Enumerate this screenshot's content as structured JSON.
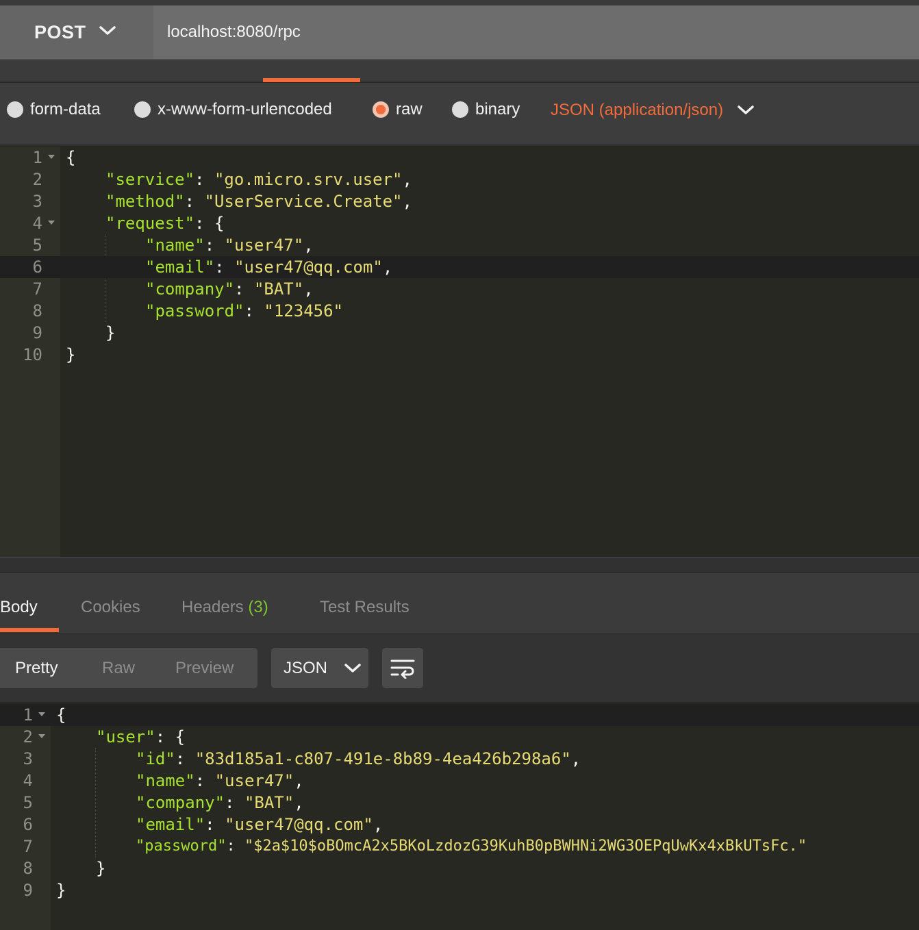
{
  "request": {
    "method": "POST",
    "url": "localhost:8080/rpc"
  },
  "body_types": {
    "options": [
      "form-data",
      "x-www-form-urlencoded",
      "raw",
      "binary"
    ],
    "selected": "raw",
    "content_type": "JSON (application/json)"
  },
  "request_body": {
    "line_numbers": [
      "1",
      "2",
      "3",
      "4",
      "5",
      "6",
      "7",
      "8",
      "9",
      "10"
    ],
    "lines": [
      "{",
      "\"service\": \"go.micro.srv.user\",",
      "\"method\": \"UserService.Create\",",
      "\"request\": {",
      "\"name\": \"user47\",",
      "\"email\": \"user47@qq.com\",",
      "\"company\": \"BAT\",",
      "\"password\": \"123456\"",
      "}",
      "}"
    ]
  },
  "response_tabs": {
    "body": "Body",
    "cookies": "Cookies",
    "headers": "Headers",
    "headers_count": "(3)",
    "test_results": "Test Results"
  },
  "response_toolbar": {
    "views": [
      "Pretty",
      "Raw",
      "Preview"
    ],
    "active_view": "Pretty",
    "format": "JSON"
  },
  "response_body": {
    "line_numbers": [
      "1",
      "2",
      "3",
      "4",
      "5",
      "6",
      "7",
      "8",
      "9"
    ],
    "lines": [
      "{",
      "\"user\": {",
      "\"id\": \"83d185a1-c807-491e-8b89-4ea426b298a6\",",
      "\"name\": \"user47\",",
      "\"company\": \"BAT\",",
      "\"email\": \"user47@qq.com\",",
      "\"password\": \"$2a$10$oBOmcA2x5BKoLzdozG39KuhB0pBWHNi2WG3OEPqUwKx4xBkUTsFc.\"",
      "}",
      "}"
    ]
  },
  "colors": {
    "accent": "#f26b3a",
    "json_key": "#a6e22e",
    "json_string": "#e6db74",
    "headers_count": "#7cc62f"
  }
}
